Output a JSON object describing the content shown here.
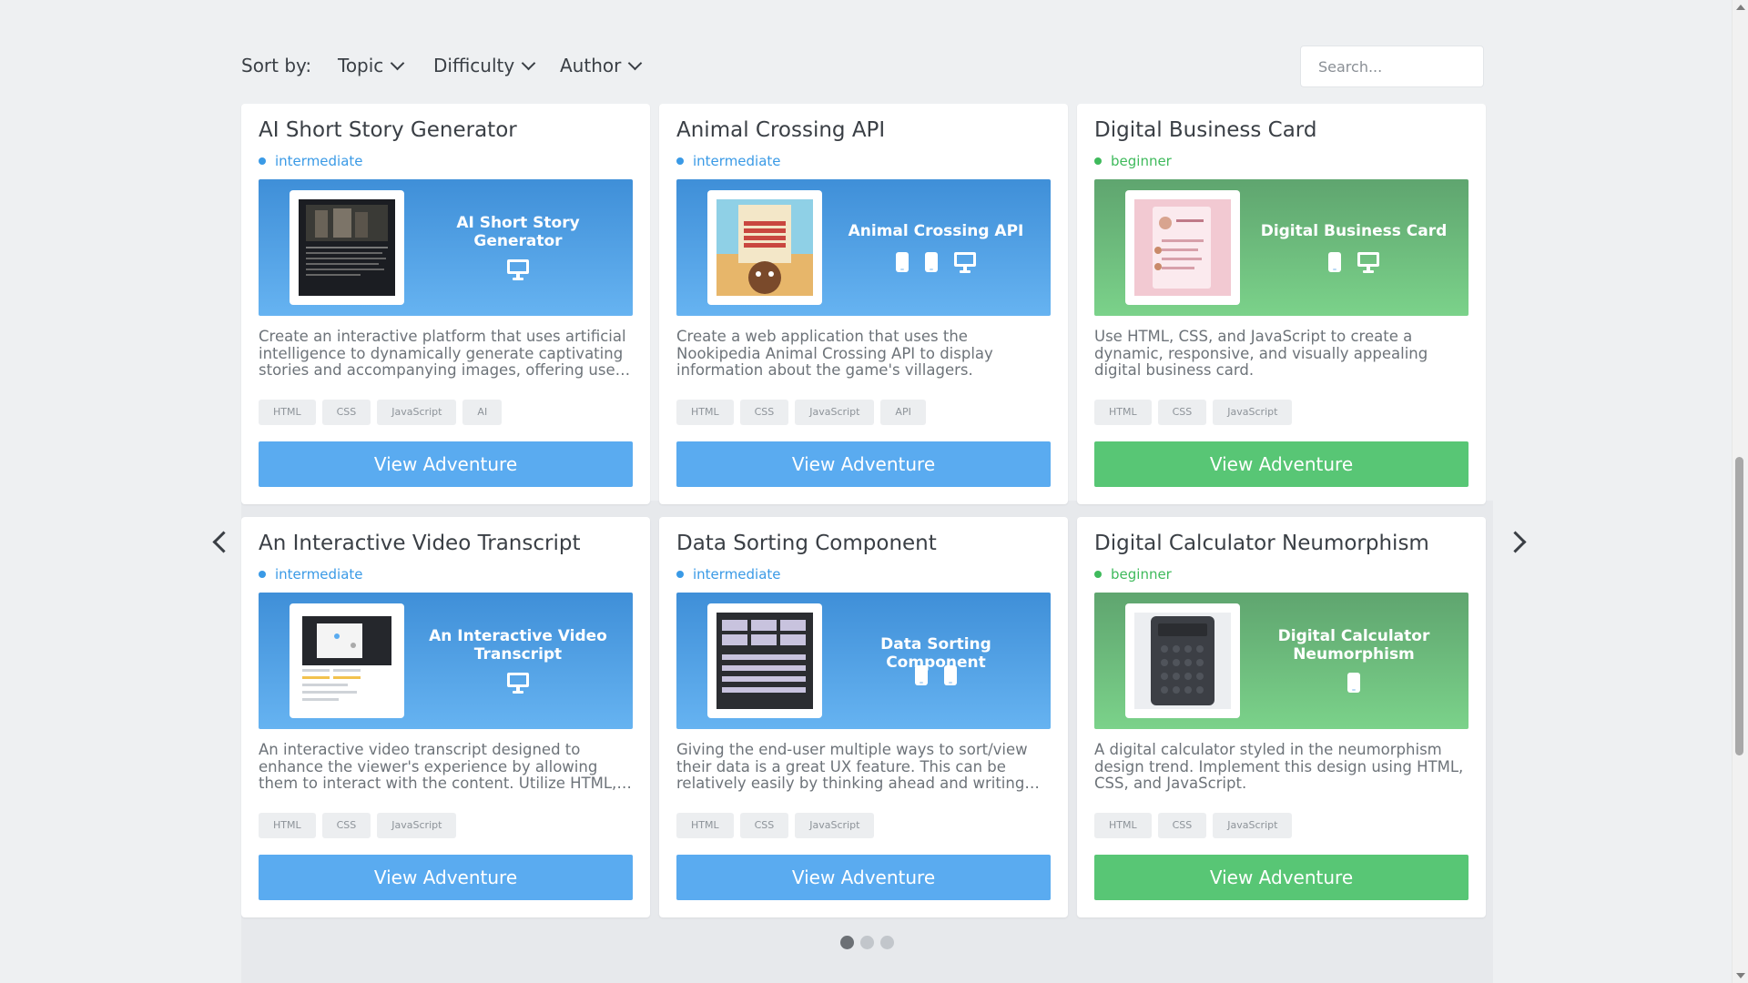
{
  "sort": {
    "label": "Sort by:",
    "options": [
      {
        "label": "Topic"
      },
      {
        "label": "Difficulty"
      },
      {
        "label": "Author"
      }
    ]
  },
  "search": {
    "placeholder": "Search..."
  },
  "button_label": "View Adventure",
  "colors": {
    "intermediate": "#3a9ae6",
    "beginner": "#3fba5c",
    "blue_button": "#5aabf0",
    "green_button": "#58c675"
  },
  "cards": [
    {
      "title": "AI Short Story Generator",
      "level": "intermediate",
      "banner_title": "AI Short Story Generator",
      "devices": [
        "monitor-icon"
      ],
      "description": "Create an interactive platform that uses artificial intelligence to dynamically generate captivating stories and accompanying images, offering users a unique storytelling experience.",
      "tags": [
        "HTML",
        "CSS",
        "JavaScript",
        "AI"
      ],
      "button": "View Adventure"
    },
    {
      "title": "Animal Crossing API",
      "level": "intermediate",
      "banner_title": "Animal Crossing API",
      "devices": [
        "phone-icon",
        "tablet-icon",
        "monitor-icon"
      ],
      "description": "Create a web application that uses the Nookipedia Animal Crossing API to display information about the game's villagers.",
      "tags": [
        "HTML",
        "CSS",
        "JavaScript",
        "API"
      ],
      "button": "View Adventure"
    },
    {
      "title": "Digital Business Card",
      "level": "beginner",
      "banner_title": "Digital Business Card",
      "devices": [
        "phone-icon",
        "monitor-icon"
      ],
      "description": "Use HTML, CSS, and JavaScript to create a dynamic, responsive, and visually appealing digital business card.",
      "tags": [
        "HTML",
        "CSS",
        "JavaScript"
      ],
      "button": "View Adventure"
    },
    {
      "title": "An Interactive Video Transcript",
      "level": "intermediate",
      "banner_title": "An Interactive Video Transcript",
      "devices": [
        "monitor-icon"
      ],
      "description": "An interactive video transcript designed to enhance the viewer's experience by allowing them to interact with the content. Utilize HTML, CSS, and JavaScript to build it.",
      "tags": [
        "HTML",
        "CSS",
        "JavaScript"
      ],
      "button": "View Adventure"
    },
    {
      "title": "Data Sorting Component",
      "level": "intermediate",
      "banner_title": "Data Sorting Component",
      "devices": [
        "phone-icon",
        "tablet-icon"
      ],
      "description": "Giving the end-user multiple ways to sort/view their data is a great UX feature. This can be relatively easily by thinking ahead and writing some good code.",
      "tags": [
        "HTML",
        "CSS",
        "JavaScript"
      ],
      "button": "View Adventure"
    },
    {
      "title": "Digital Calculator Neumorphism",
      "level": "beginner",
      "banner_title": "Digital Calculator Neumorphism",
      "devices": [
        "phone-icon"
      ],
      "description": "A digital calculator styled in the neumorphism design trend. Implement this design using HTML, CSS, and JavaScript.",
      "tags": [
        "HTML",
        "CSS",
        "JavaScript"
      ],
      "button": "View Adventure"
    }
  ],
  "pagination": {
    "pages": 3,
    "active": 1
  }
}
